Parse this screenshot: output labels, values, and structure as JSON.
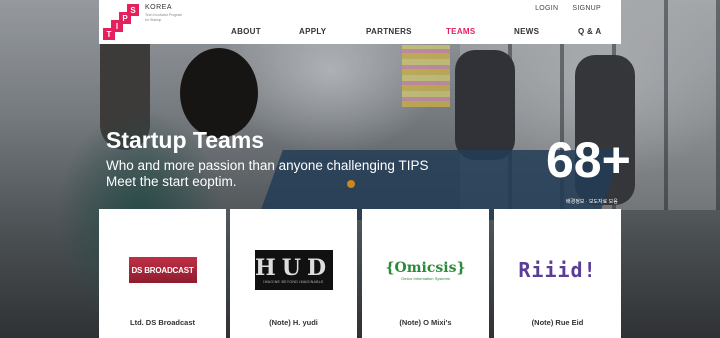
{
  "logo": {
    "letters": [
      "S",
      "P",
      "I",
      "T"
    ],
    "korea": "KOREA",
    "tagline": "Tech Incubator Program for Startup",
    "brand_color": "#e4205d"
  },
  "util_nav": [
    "LOGIN",
    "SIGNUP"
  ],
  "nav": {
    "items": [
      "ABOUT",
      "APPLY",
      "PARTNERS",
      "TEAMS",
      "NEWS",
      "Q & A"
    ],
    "active": "TEAMS"
  },
  "hero": {
    "title": "Startup Teams",
    "subtitle_line1": "Who and more passion than anyone challenging TIPS",
    "subtitle_line2": "Meet the start eoptim.",
    "counter": "68+",
    "counter_caption": "배경정보 · 보도자료 모음"
  },
  "cards": [
    {
      "name": "Ltd. DS Broadcast",
      "logo_text": "DS BROADCAST"
    },
    {
      "name": "(Note) H. yudi",
      "logo_text": "HUD",
      "logo_sub": "IMAGINE BEYOND IMAGINABLE"
    },
    {
      "name": "(Note) O Mixi's",
      "logo_text": "{Omicsis}",
      "logo_sub": "Omics Information Systems"
    },
    {
      "name": "(Note) Rue Eid",
      "logo_text": "Riiid!"
    }
  ]
}
